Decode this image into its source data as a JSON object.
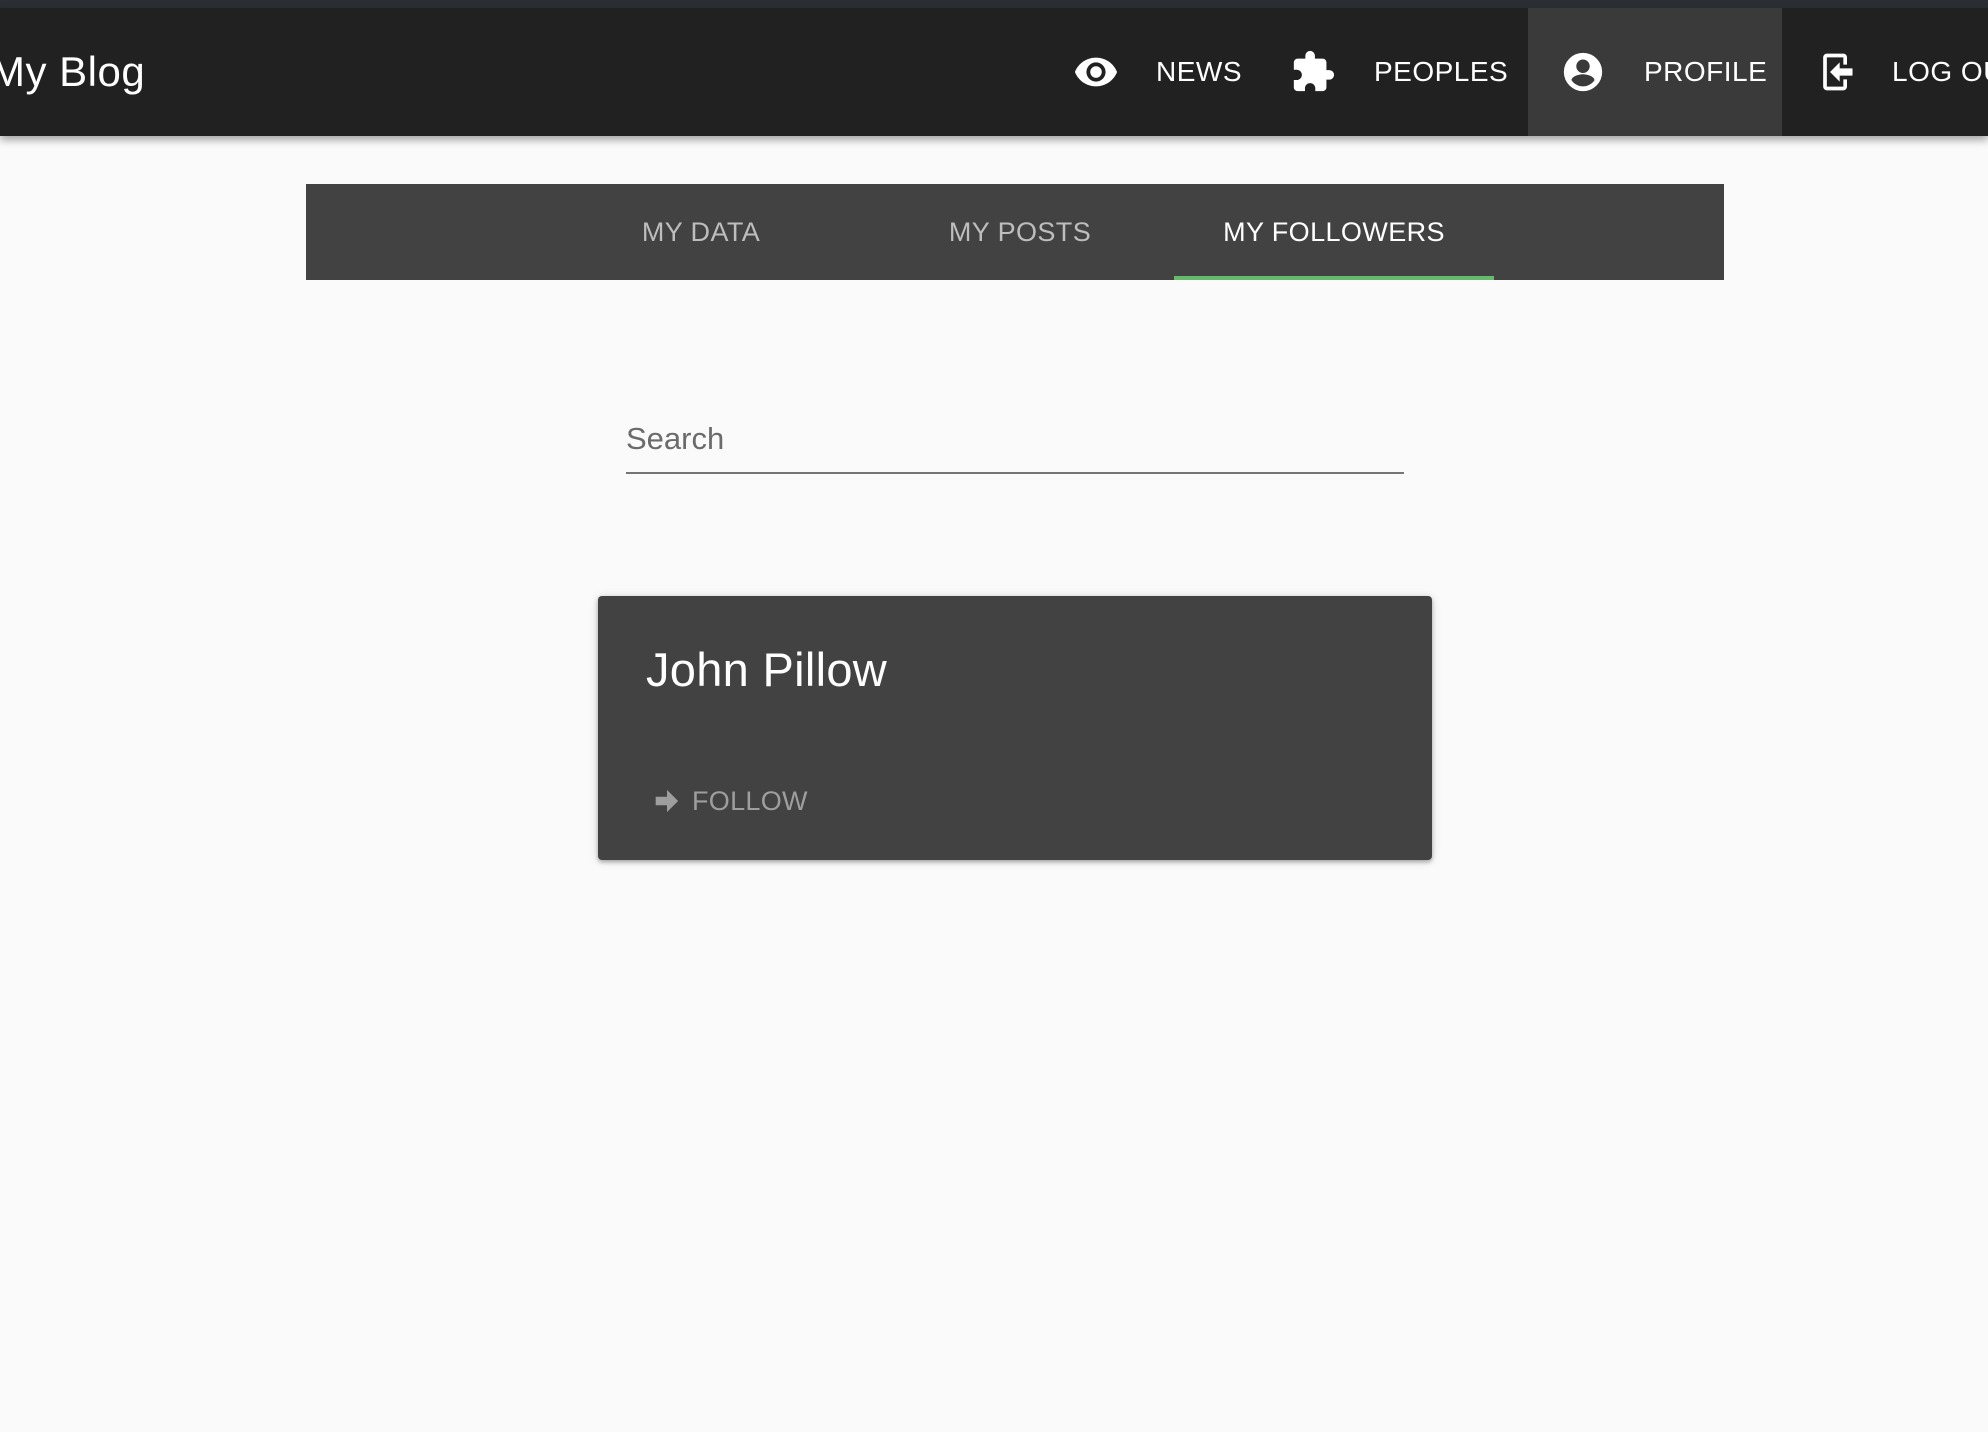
{
  "app": {
    "title": "My Blog"
  },
  "nav": {
    "items": [
      {
        "label": "NEWS",
        "icon": "eye-icon"
      },
      {
        "label": "PEOPLES",
        "icon": "puzzle-icon"
      },
      {
        "label": "PROFILE",
        "icon": "account-circle-icon",
        "active": true
      },
      {
        "label": "LOG OU",
        "icon": "login-box-icon"
      }
    ]
  },
  "tabs": {
    "items": [
      {
        "label": "MY DATA"
      },
      {
        "label": "MY POSTS"
      },
      {
        "label": "MY FOLLOWERS",
        "active": true
      }
    ],
    "accent_color": "#66bb6a"
  },
  "search": {
    "placeholder": "Search",
    "value": ""
  },
  "followers": [
    {
      "name": "John Pillow",
      "action_label": "FOLLOW",
      "action_icon": "arrow-right-bold-icon"
    }
  ],
  "colors": {
    "appbar": "#212121",
    "tabs_bg": "#424242",
    "card_bg": "#424242",
    "page_bg": "#fafafa"
  }
}
